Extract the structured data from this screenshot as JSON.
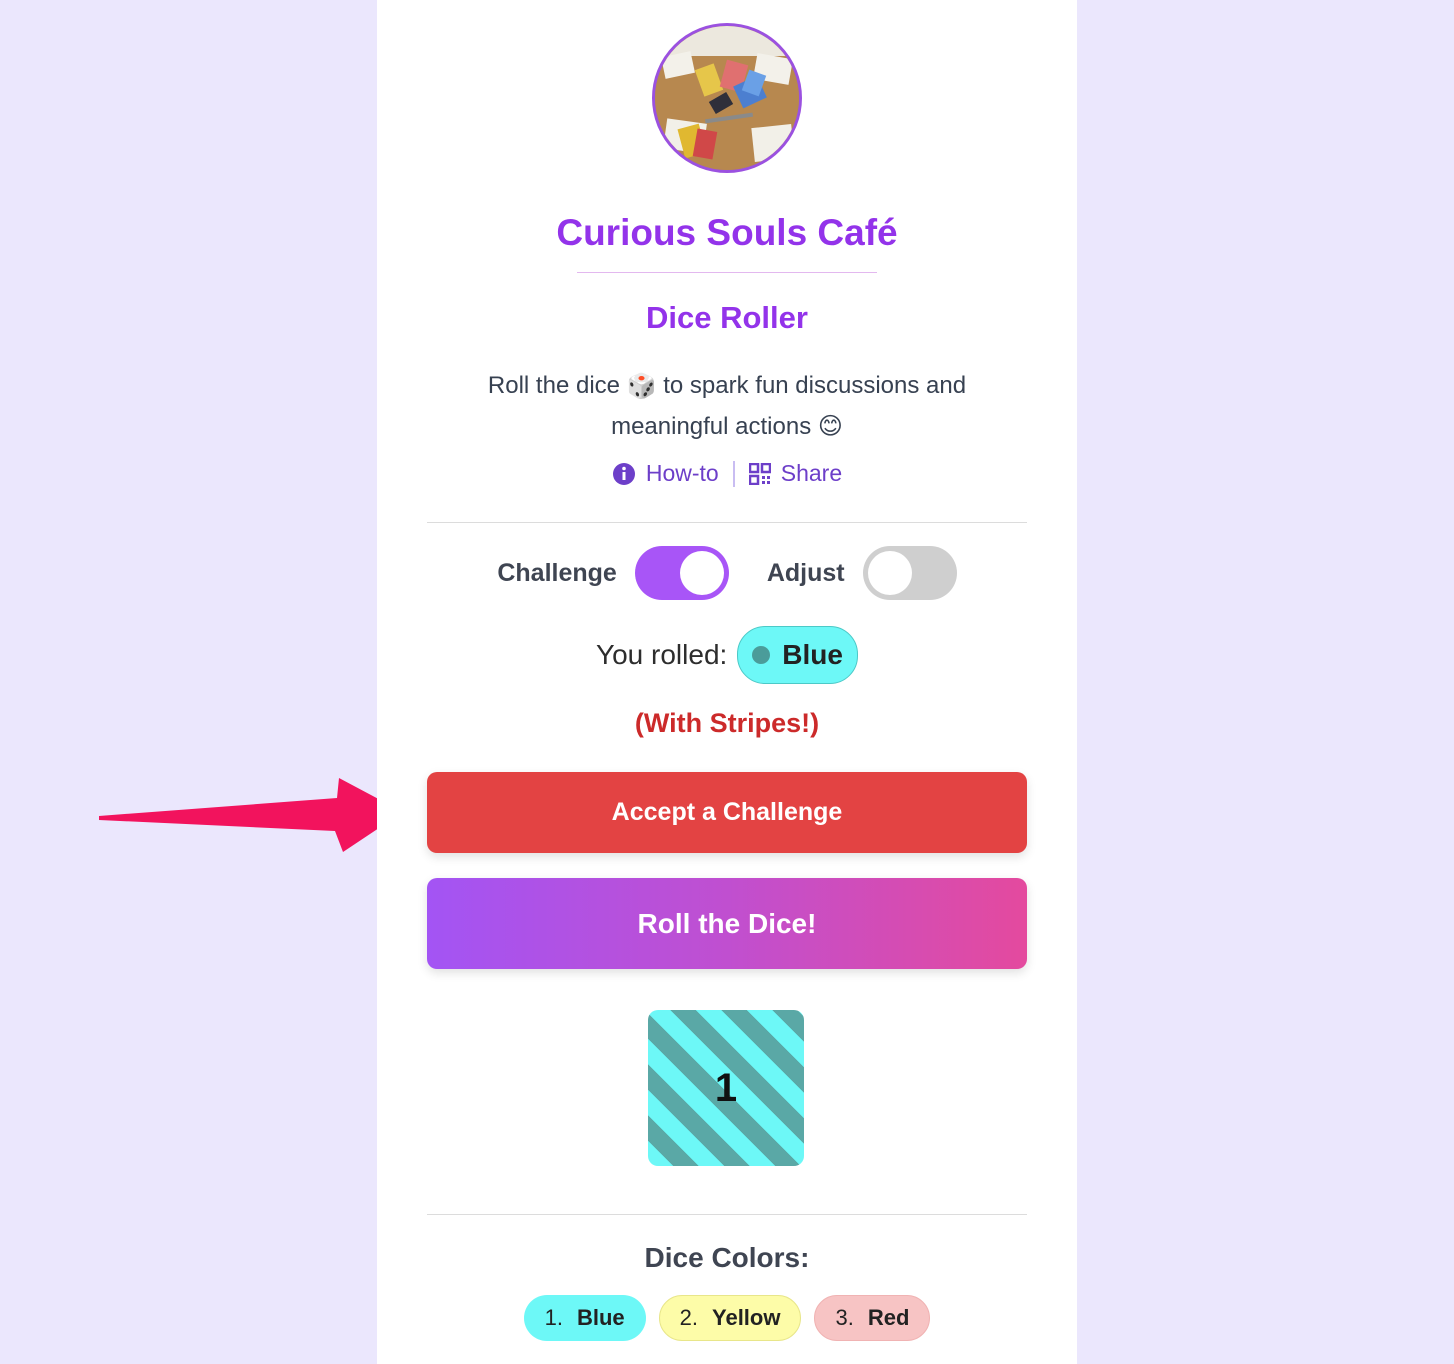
{
  "header": {
    "cafe_name": "Curious Souls Café",
    "tool_name": "Dice Roller",
    "description_part1": "Roll the dice",
    "description_part2": "to spark fun discussions and meaningful actions",
    "dice_emoji": "🎲",
    "smile_emoji": "😊"
  },
  "links": {
    "howto_label": "How-to",
    "howto_icon": "info-icon",
    "share_label": "Share",
    "share_icon": "qr-code-icon"
  },
  "toggles": {
    "challenge_label": "Challenge",
    "challenge_on": true,
    "adjust_label": "Adjust",
    "adjust_on": false
  },
  "result": {
    "rolled_label": "You rolled:",
    "color_name": "Blue",
    "modifier": "(With Stripes!)",
    "die_value": "1"
  },
  "buttons": {
    "challenge_label": "Accept a Challenge",
    "roll_label": "Roll the Dice!"
  },
  "dice_colors": {
    "title": "Dice Colors:",
    "items": [
      {
        "number": "1.",
        "name": "Blue",
        "color": "#6df8f7",
        "border": "#6df8f7"
      },
      {
        "number": "2.",
        "name": "Yellow",
        "color": "#fdfca8",
        "border": "#e8e68a"
      },
      {
        "number": "3.",
        "name": "Red",
        "color": "#f7c4c4",
        "border": "#f0b3b3"
      }
    ]
  },
  "colors": {
    "accent_purple": "#9333ea",
    "challenge_red": "#e34343",
    "die_blue": "#6df8f7",
    "annotation_arrow": "#f2135d"
  }
}
